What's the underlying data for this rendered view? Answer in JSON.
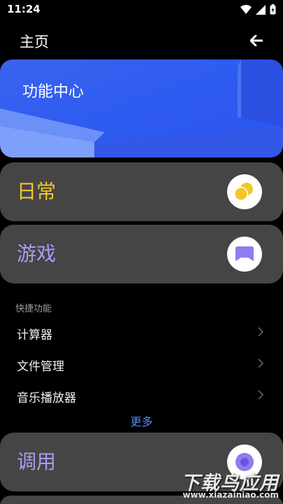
{
  "status": {
    "time": "11:24"
  },
  "header": {
    "title": "主页"
  },
  "banner": {
    "title": "功能中心"
  },
  "cards": [
    {
      "label": "日常",
      "color": "#f3c72a"
    },
    {
      "label": "游戏",
      "color": "#a89cf5"
    },
    {
      "label": "调用",
      "color": "#a89cf5"
    }
  ],
  "quick": {
    "section_label": "快捷功能",
    "items": [
      "计算器",
      "文件管理",
      "音乐播放器"
    ],
    "more": "更多"
  },
  "watermark": {
    "text": "下载鸟应用",
    "url": "www.xiazainiao.com"
  }
}
